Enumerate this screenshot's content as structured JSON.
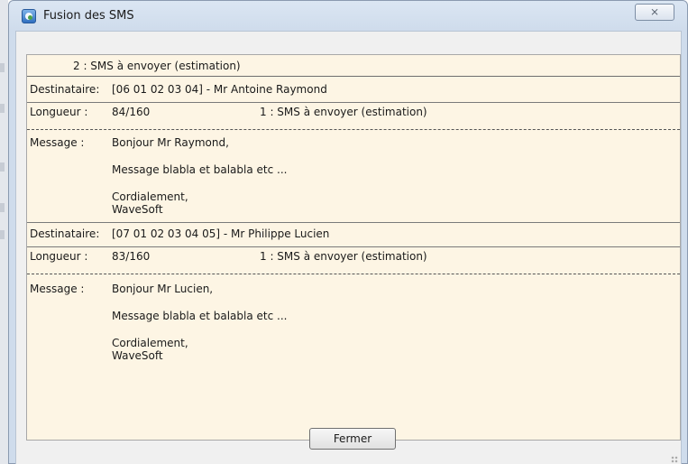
{
  "window": {
    "title": "Fusion des SMS",
    "close_label": "⨯"
  },
  "summary": {
    "text": "2 : SMS à envoyer (estimation)"
  },
  "messages": [
    {
      "recipient_label": "Destinataire:",
      "recipient": "[06 01 02 03 04] - Mr Antoine Raymond",
      "length_label": "Longueur :",
      "length": "84/160",
      "estimate": "1 : SMS à envoyer (estimation)",
      "message_label": "Message :",
      "lines": [
        "Bonjour Mr Raymond,",
        "Message blabla et balabla etc ...",
        "Cordialement,",
        "WaveSoft"
      ]
    },
    {
      "recipient_label": "Destinataire:",
      "recipient": "[07 01 02 03 04 05] - Mr Philippe Lucien",
      "length_label": "Longueur :",
      "length": "83/160",
      "estimate": "1 : SMS à envoyer (estimation)",
      "message_label": "Message :",
      "lines": [
        "Bonjour Mr Lucien,",
        "Message blabla et balabla etc ...",
        "Cordialement,",
        "WaveSoft"
      ]
    }
  ],
  "footer": {
    "close_button": "Fermer"
  },
  "colors": {
    "content_bg": "#fdf5e4",
    "window_frame": "#cfdcec"
  }
}
